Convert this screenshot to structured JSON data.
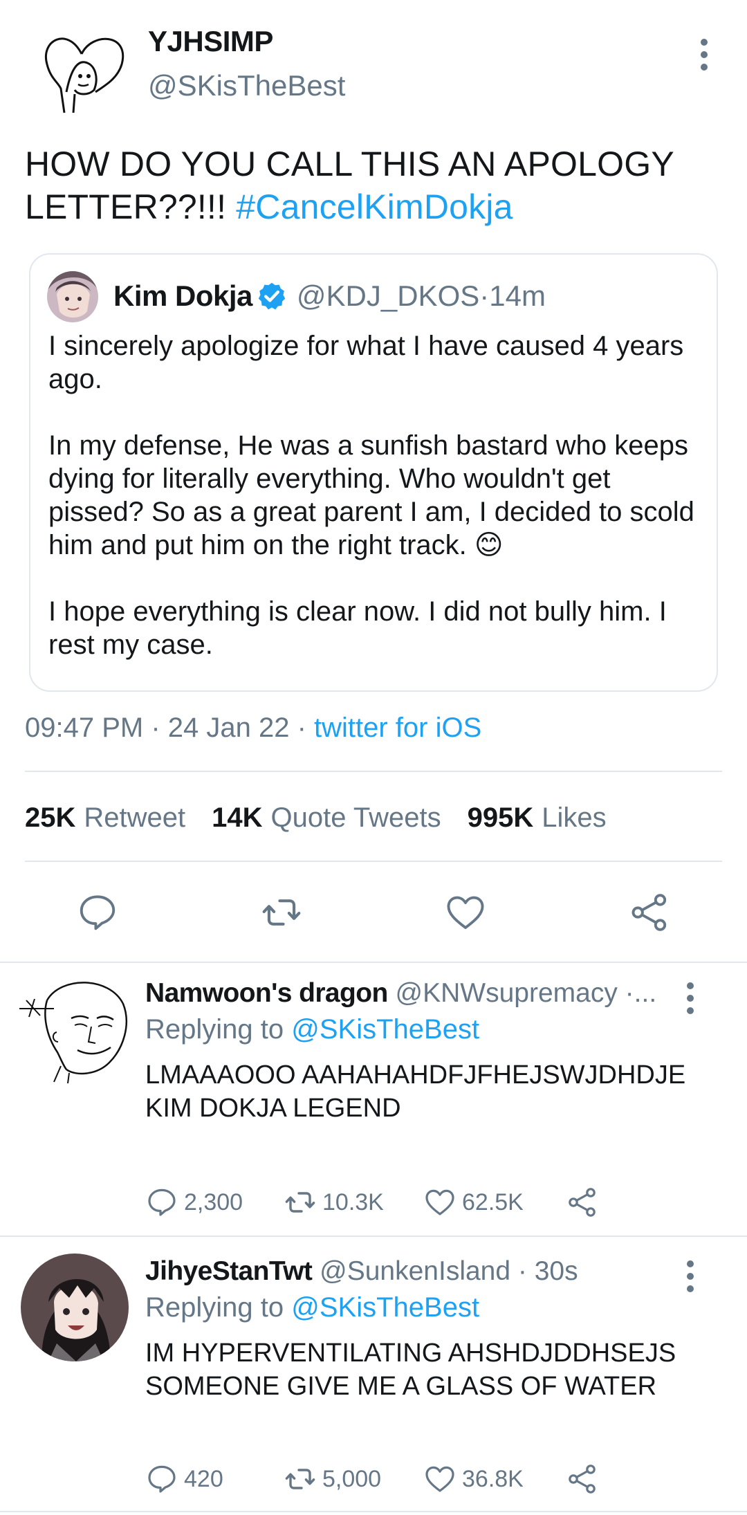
{
  "tweet": {
    "display_name": "YJHSIMP",
    "handle": "@SKisTheBest",
    "text_plain": "HOW DO YOU CALL THIS AN APOLOGY LETTER??!!! ",
    "hashtag": "#CancelKimDokja",
    "time": "09:47 PM",
    "sep1": " · ",
    "date": "24 Jan 22",
    "sep2": " · ",
    "client": "twitter for iOS"
  },
  "quote": {
    "display_name": "Kim Dokja",
    "handle": "@KDJ_DKOS",
    "sep": " · ",
    "age": "14m",
    "paragraph1": "I sincerely apologize for what I have caused 4 years ago.",
    "paragraph2": "In my defense, He was a sunfish bastard who keeps dying for literally everything. Who wouldn't get pissed? So as a great parent I am, I decided to scold him and put him on the right track. 😊",
    "paragraph3": "I hope everything is clear now. I did not bully him. I rest my case."
  },
  "stats": {
    "retweets_count": "25K",
    "retweets_label": "Retweet",
    "quotes_count": "14K",
    "quotes_label": "Quote Tweets",
    "likes_count": "995K",
    "likes_label": "Likes"
  },
  "icons": {
    "reply": "reply-icon",
    "retweet": "retweet-icon",
    "like": "heart-icon",
    "share": "share-icon",
    "more": "more-vertical-icon",
    "verified": "verified-badge-icon"
  },
  "colors": {
    "accent": "#1da1f2",
    "secondary_text": "#657786",
    "divider": "#e1e8ed"
  },
  "replies": [
    {
      "display_name": "Namwoon's dragon",
      "handle_meta": " @KNWsupremacy ·...",
      "replying_prefix": "Replying to ",
      "replying_handle": "@SKisTheBest",
      "text": "LMAAAOOO AAHAHAHDFJFHEJSWJDHDJE KIM DOKJA LEGEND",
      "replies": "2,300",
      "retweets": "10.3K",
      "likes": "62.5K"
    },
    {
      "display_name": "JihyeStanTwt",
      "handle_meta": " @SunkenIsland · 30s",
      "replying_prefix": "Replying to ",
      "replying_handle": "@SKisTheBest",
      "text": "IM HYPERVENTILATING AHSHDJDDHSEJS SOMEONE GIVE ME A GLASS OF WATER",
      "replies": "420",
      "retweets": "5,000",
      "likes": "36.8K"
    }
  ]
}
